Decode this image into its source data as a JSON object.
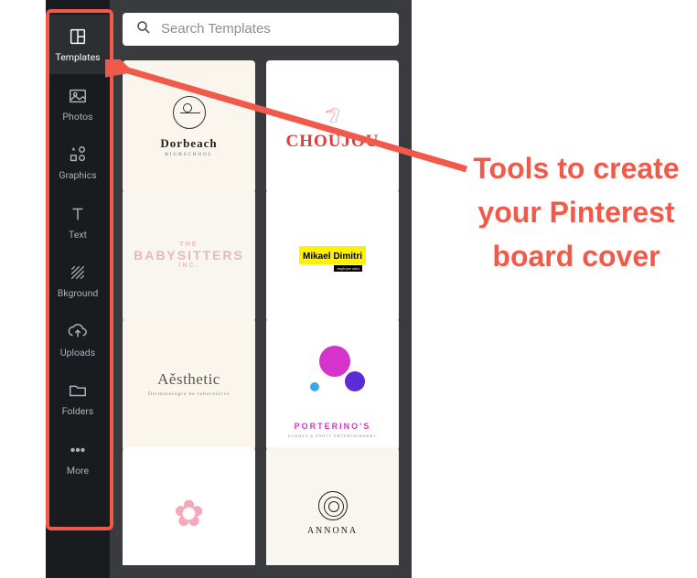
{
  "sidebar": {
    "items": [
      {
        "label": "Templates",
        "icon": "templates-icon"
      },
      {
        "label": "Photos",
        "icon": "photos-icon"
      },
      {
        "label": "Graphics",
        "icon": "graphics-icon"
      },
      {
        "label": "Text",
        "icon": "text-icon"
      },
      {
        "label": "Bkground",
        "icon": "background-icon"
      },
      {
        "label": "Uploads",
        "icon": "uploads-icon"
      },
      {
        "label": "Folders",
        "icon": "folders-icon"
      },
      {
        "label": "More",
        "icon": "more-icon"
      }
    ]
  },
  "search": {
    "placeholder": "Search Templates",
    "value": ""
  },
  "templates": [
    {
      "title": "Dorbeach",
      "subtitle": "HIGHSCHOOL"
    },
    {
      "title": "CHOUJOU"
    },
    {
      "the": "THE",
      "title": "BABYSITTERS",
      "subtitle": "INC."
    },
    {
      "title": "Mikael Dimitri",
      "subtitle": "employee artist"
    },
    {
      "title": "Aěsthetic",
      "subtitle": "Dermatologia\nde laboratório"
    },
    {
      "title": "PORTERINO'S",
      "subtitle": "EVENTS & PARTY ENTERTAINMENT"
    },
    {
      "title": ""
    },
    {
      "title": "ANNONA"
    }
  ],
  "annotation": {
    "text": "Tools to create your Pinterest board cover",
    "color": "#f15a4a"
  }
}
